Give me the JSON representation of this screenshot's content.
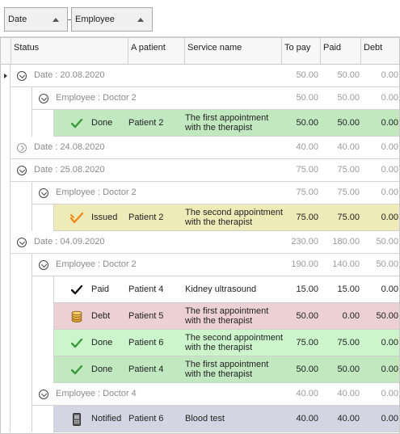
{
  "group_panel": {
    "chips": [
      {
        "label": "Date"
      },
      {
        "label": "Employee"
      }
    ]
  },
  "columns": {
    "status": "Status",
    "patient": "A patient",
    "service": "Service name",
    "to_pay": "To pay",
    "paid": "Paid",
    "debt": "Debt"
  },
  "groups": [
    {
      "label": "Date : 20.08.2020",
      "to_pay": "50.00",
      "paid": "50.00",
      "debt": "0.00",
      "employees": [
        {
          "label": "Employee : Doctor 2",
          "to_pay": "50.00",
          "paid": "50.00",
          "debt": "0.00",
          "rows": [
            {
              "status": "Done",
              "patient": "Patient 2",
              "service_1": "The first appointment",
              "service_2": "with the therapist",
              "to_pay": "50.00",
              "paid": "50.00",
              "debt": "0.00",
              "icon": "green-check-icon",
              "bg": "#c2e8c0"
            }
          ]
        }
      ]
    },
    {
      "label": "Date : 24.08.2020",
      "to_pay": "40.00",
      "paid": "40.00",
      "debt": "0.00"
    },
    {
      "label": "Date : 25.08.2020",
      "to_pay": "75.00",
      "paid": "75.00",
      "debt": "0.00",
      "employees": [
        {
          "label": "Employee : Doctor 2",
          "to_pay": "75.00",
          "paid": "75.00",
          "debt": "0.00",
          "rows": [
            {
              "status": "Issued",
              "patient": "Patient 2",
              "service_1": "The second appointment",
              "service_2": "with the therapist",
              "to_pay": "75.00",
              "paid": "75.00",
              "debt": "0.00",
              "icon": "orange-check-icon",
              "bg": "#eeebb8"
            }
          ]
        }
      ]
    },
    {
      "label": "Date : 04.09.2020",
      "to_pay": "230.00",
      "paid": "180.00",
      "debt": "50.00",
      "employees": [
        {
          "label": "Employee : Doctor 2",
          "to_pay": "190.00",
          "paid": "140.00",
          "debt": "50.00",
          "rows": [
            {
              "status": "Paid",
              "patient": "Patient 4",
              "service_1": "Kidney ultrasound",
              "service_2": "",
              "to_pay": "15.00",
              "paid": "15.00",
              "debt": "0.00",
              "icon": "black-check-icon",
              "bg": "#ffffff"
            },
            {
              "status": "Debt",
              "patient": "Patient 5",
              "service_1": "The first appointment",
              "service_2": "with the therapist",
              "to_pay": "50.00",
              "paid": "0.00",
              "debt": "50.00",
              "icon": "coins-icon",
              "bg": "#ecd0d4"
            },
            {
              "status": "Done",
              "patient": "Patient 6",
              "service_1": "The second appointment",
              "service_2": "with the therapist",
              "to_pay": "75.00",
              "paid": "75.00",
              "debt": "0.00",
              "icon": "green-check-icon",
              "bg": "#ccf5cc"
            },
            {
              "status": "Done",
              "patient": "Patient 4",
              "service_1": "The first appointment",
              "service_2": "with the therapist",
              "to_pay": "50.00",
              "paid": "50.00",
              "debt": "0.00",
              "icon": "green-check-icon",
              "bg": "#c2e8c0"
            }
          ]
        },
        {
          "label": "Employee : Doctor 4",
          "to_pay": "40.00",
          "paid": "40.00",
          "debt": "0.00",
          "rows": [
            {
              "status": "Notified",
              "patient": "Patient 6",
              "service_1": "Blood test",
              "service_2": "",
              "to_pay": "40.00",
              "paid": "40.00",
              "debt": "0.00",
              "icon": "phone-icon",
              "bg": "#d5d4e3"
            }
          ]
        }
      ]
    }
  ]
}
